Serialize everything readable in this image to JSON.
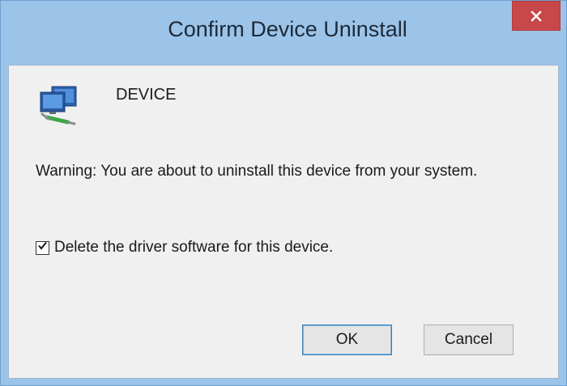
{
  "window": {
    "title": "Confirm Device Uninstall",
    "close_icon": "close-icon"
  },
  "dialog": {
    "device_icon": "network-adapter-icon",
    "device_name": "DEVICE",
    "warning": "Warning: You are about to uninstall this device from your system.",
    "checkbox": {
      "label": "Delete the driver software for this device.",
      "checked": true
    },
    "buttons": {
      "ok_label": "OK",
      "cancel_label": "Cancel"
    }
  },
  "colors": {
    "titlebar": "#9cc4e9",
    "close_button": "#c7474b",
    "client_background": "#f0f0f0",
    "default_button_border": "#3c7fb1"
  }
}
